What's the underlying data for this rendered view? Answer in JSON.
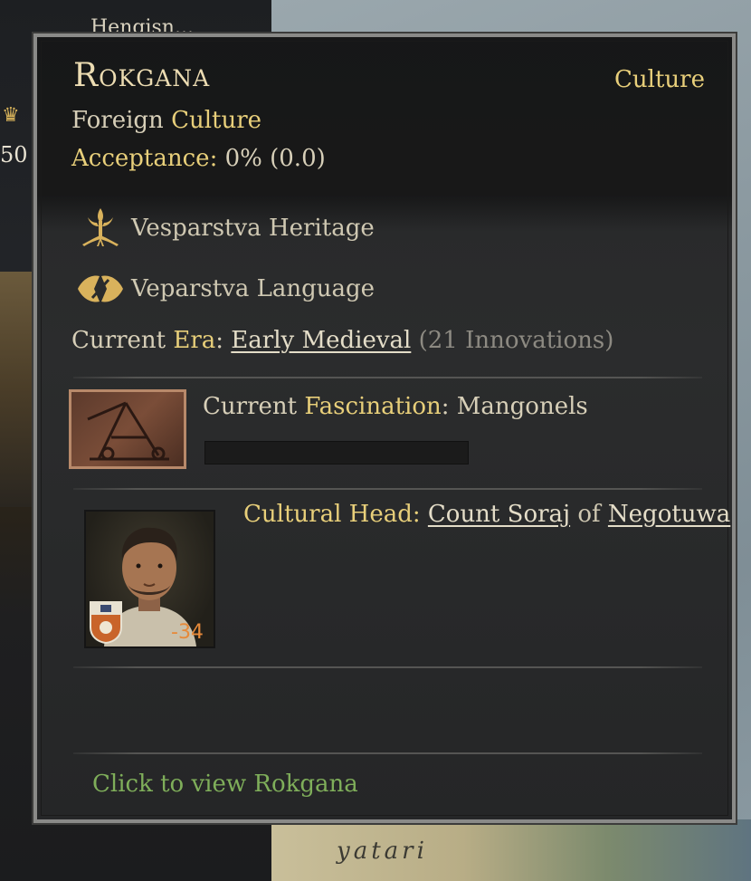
{
  "background": {
    "character_name_fragment": "Hengisn...",
    "side_number": "50",
    "map_label": "yatari"
  },
  "tooltip": {
    "title": "Rokgana",
    "type_label": "Culture",
    "foreign_prefix": "Foreign",
    "foreign_word": "Culture",
    "acceptance_label": "Acceptance:",
    "acceptance_value": "0% (0.0)",
    "heritage": {
      "label": "Vesparstva Heritage",
      "icon": "heritage-icon"
    },
    "language": {
      "label": "Veparstva Language",
      "icon": "language-icon"
    },
    "era": {
      "prefix": "Current",
      "era_word": "Era",
      "colon": ":",
      "value": "Early Medieval",
      "innovations": "(21 Innovations)"
    },
    "fascination": {
      "prefix": "Current",
      "word": "Fascination",
      "colon": ":",
      "value": "Mangonels",
      "progress": 0
    },
    "cultural_head": {
      "label": "Cultural Head:",
      "name": "Count Soraj",
      "of": "of",
      "realm": "Negotuwa",
      "age": "-34"
    },
    "click_hint": "Click to view Rokgana"
  },
  "colors": {
    "gold": "#e8cf7a",
    "hint_green": "#7fae5a",
    "age_orange": "#e78a3a"
  }
}
